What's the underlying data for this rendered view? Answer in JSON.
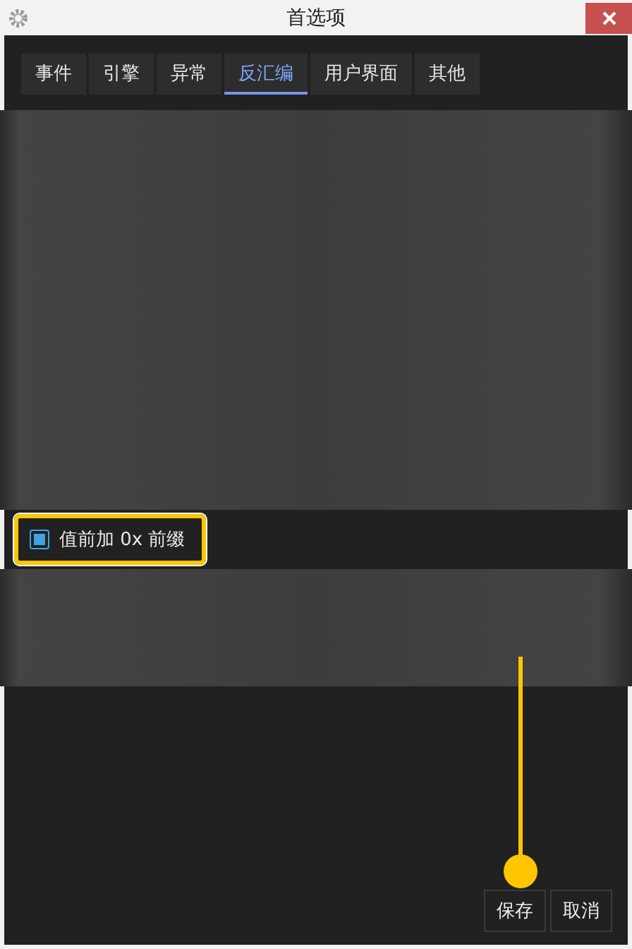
{
  "window": {
    "title": "首选项"
  },
  "tabs": [
    {
      "label": "事件",
      "selected": false
    },
    {
      "label": "引擎",
      "selected": false
    },
    {
      "label": "异常",
      "selected": false
    },
    {
      "label": "反汇编",
      "selected": true
    },
    {
      "label": "用户界面",
      "selected": false
    },
    {
      "label": "其他",
      "selected": false
    }
  ],
  "option": {
    "label": "值前加 0x 前缀",
    "checked": true,
    "highlighted": true
  },
  "buttons": [
    "保存",
    "取消"
  ]
}
